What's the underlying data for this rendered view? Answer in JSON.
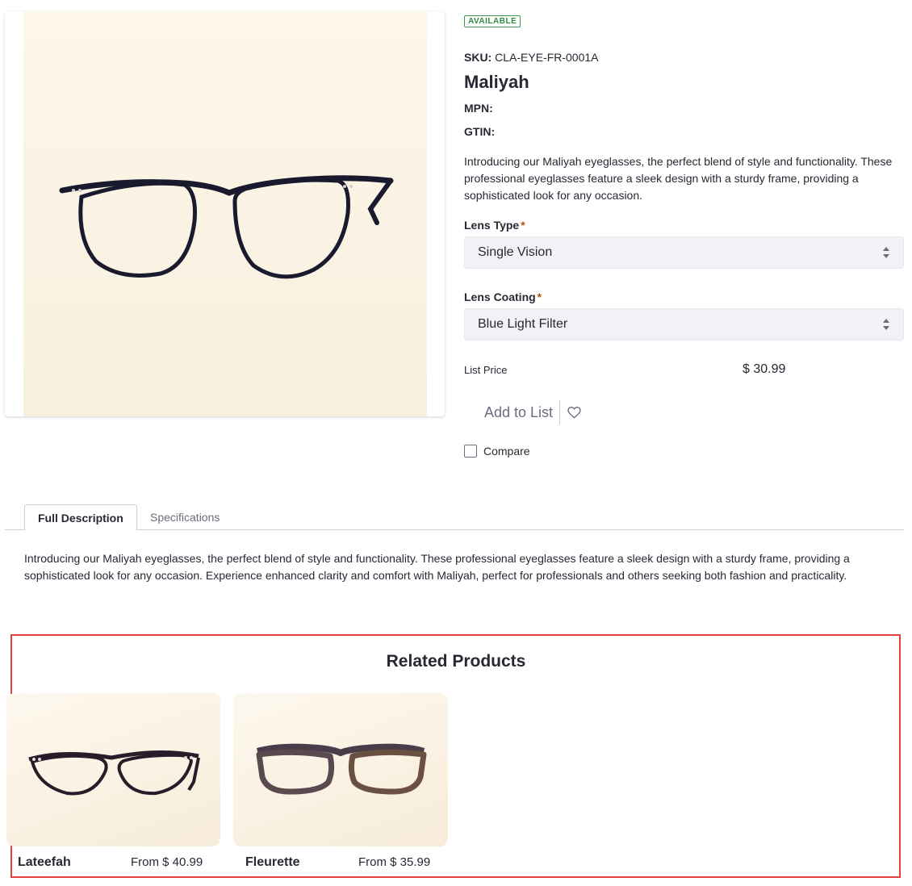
{
  "product": {
    "availability": "AVAILABLE",
    "sku_label": "SKU:",
    "sku_value": "CLA-EYE-FR-0001A",
    "name": "Maliyah",
    "mpn_label": "MPN:",
    "gtin_label": "GTIN:",
    "short_description": "Introducing our Maliyah eyeglasses, the perfect blend of style and functionality. These professional eyeglasses feature a sleek design with a sturdy frame, providing a sophisticated look for any occasion.",
    "image_icon": "eyeglasses-image"
  },
  "options": {
    "lens_type_label": "Lens Type",
    "lens_type_value": "Single Vision",
    "lens_coating_label": "Lens Coating",
    "lens_coating_value": "Blue Light Filter",
    "required_mark": "*"
  },
  "pricing": {
    "list_price_label": "List Price",
    "list_price_value": "$ 30.99"
  },
  "actions": {
    "add_to_list_label": "Add to List",
    "heart_icon": "heart-icon",
    "compare_label": "Compare"
  },
  "tabs": [
    {
      "label": "Full Description",
      "active": true
    },
    {
      "label": "Specifications",
      "active": false
    }
  ],
  "full_description": "Introducing our Maliyah eyeglasses, the perfect blend of style and functionality. These professional eyeglasses feature a sleek design with a sturdy frame, providing a sophisticated look for any occasion. Experience enhanced clarity and comfort with Maliyah, perfect for professionals and others seeking both fashion and practicality.",
  "related": {
    "title": "Related Products",
    "items": [
      {
        "name": "Lateefah",
        "price": "From $ 40.99"
      },
      {
        "name": "Fleurette",
        "price": "From $ 35.99"
      }
    ]
  },
  "colors": {
    "available": "#2e8a40",
    "required": "#b95000",
    "highlight_border": "#e5403a"
  }
}
